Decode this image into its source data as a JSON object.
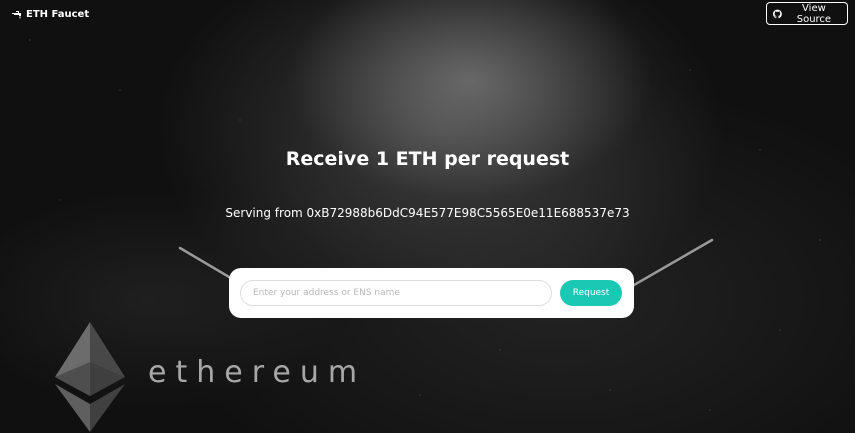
{
  "header": {
    "brand_label": "ETH Faucet",
    "brand_icon": "faucet-icon",
    "view_source_label": "View Source",
    "view_source_icon": "github-icon"
  },
  "main": {
    "title": "Receive 1 ETH per request",
    "serving_text": "Serving from 0xB72988b6DdC94E577E98C5565E0e11E688537e73"
  },
  "form": {
    "address_placeholder": "Enter your address or ENS name",
    "address_value": "",
    "request_label": "Request"
  },
  "background": {
    "wordmark": "ethereum",
    "logo": "ethereum-diamond-logo"
  },
  "colors": {
    "accent": "#1ac9b3",
    "background": "#101010",
    "text": "#ffffff"
  }
}
